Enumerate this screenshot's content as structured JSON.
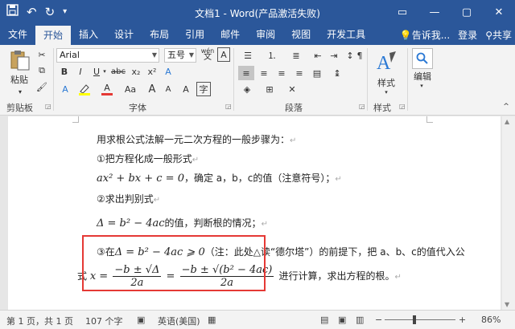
{
  "window": {
    "title": "文档1 - Word(产品激活失败)",
    "qat": {
      "save_icon": "save-icon",
      "undo_symbol": "↶",
      "redo_symbol": "↻"
    }
  },
  "tabs": [
    "文件",
    "开始",
    "插入",
    "设计",
    "布局",
    "引用",
    "邮件",
    "审阅",
    "视图",
    "开发工具"
  ],
  "active_tab": "开始",
  "tabs_right": {
    "tell_me": "告诉我...",
    "signin": "登录",
    "share": "共享"
  },
  "ribbon": {
    "groups": {
      "clipboard": "剪贴板",
      "font": "字体",
      "paragraph": "段落",
      "styles_group": "样式"
    },
    "paste_label": "粘贴",
    "font_name": "Arial",
    "font_size": "五号",
    "wen_label": "wén",
    "styles_button": "样式",
    "edit_button": "编辑",
    "font_buttons": {
      "bold": "B",
      "italic": "I",
      "underline": "U",
      "strike": "abc",
      "sub": "x₂",
      "sup": "x²",
      "grow": "A",
      "shrink": "A",
      "case": "Aa",
      "color": "A",
      "clear": "A",
      "border_a": "A",
      "phonetic": "A"
    }
  },
  "document": {
    "line1": "用求根公式法解一元二次方程的一般步骤为：",
    "line2": "①把方程化成一般形式",
    "line3_math": "ax² + bx + c = 0",
    "line3_text": "，确定 a，b，c的值（注意符号）；",
    "line4": "②求出判别式",
    "line5_math": "Δ = b² − 4ac",
    "line5_text": "的值，判断根的情况；",
    "line6_prefix": "③在",
    "line6_math": "Δ = b² − 4ac ⩾ 0",
    "line6_text": "（注：此处△读“德尔塔”）的前提下，把 a、b、c的值代入公",
    "line7_prefix": "式",
    "line7_x": "x =",
    "frac1_num": "−b ± √Δ",
    "frac1_den": "2a",
    "frac2_num": "−b ± √(b² − 4ac)",
    "frac2_den": "2a",
    "line7_text": "进行计算，求出方程的根。",
    "para_mark": "↵"
  },
  "status": {
    "page": "第 1 页，共 1 页",
    "words": "107 个字",
    "language": "英语(美国)",
    "zoom": "86%",
    "zoom_value": 86
  }
}
